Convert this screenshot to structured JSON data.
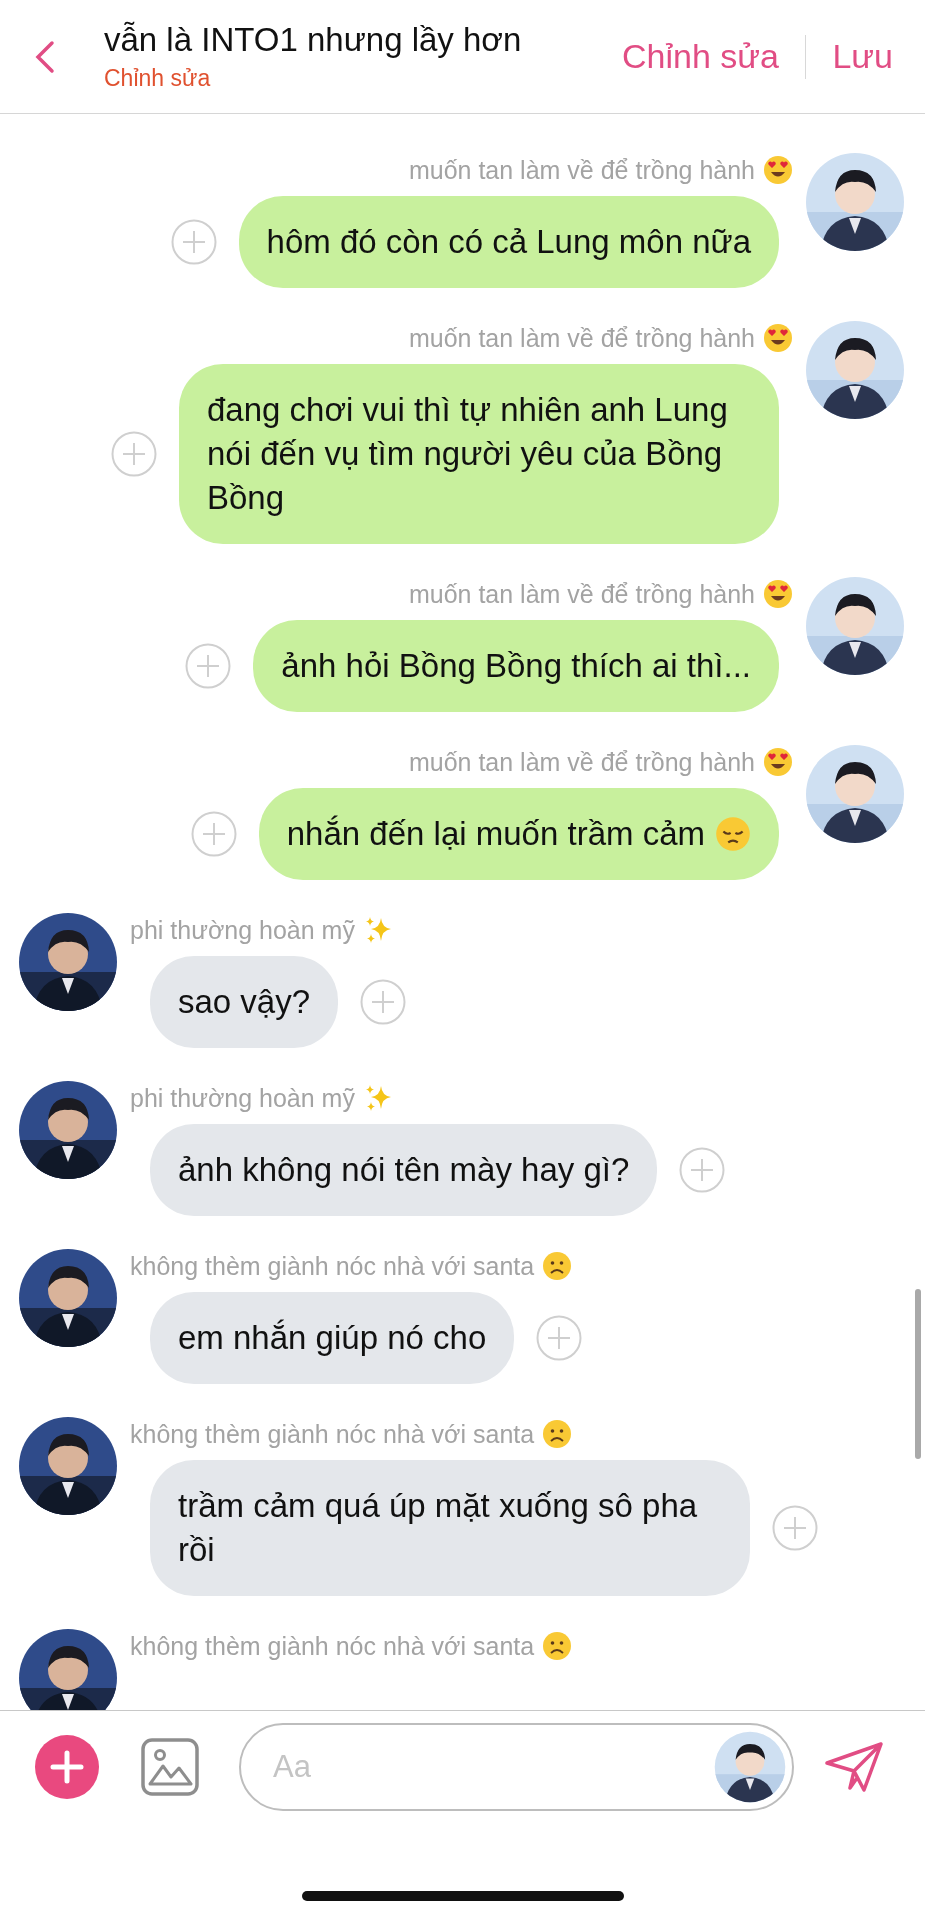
{
  "header": {
    "title": "vẫn là INTO1 nhưng lầy hơn",
    "subtitle": "Chỉnh sửa",
    "actions": [
      "Chỉnh sửa",
      "Lưu"
    ]
  },
  "messages": [
    {
      "kind": "sent",
      "sender": "muốn tan làm về để trồng hành",
      "sender_emoji": {
        "kind": "heart-eyes"
      },
      "text": "hôm đó còn có cả Lung môn nữa"
    },
    {
      "kind": "sent",
      "sender": "muốn tan làm về để trồng hành",
      "sender_emoji": {
        "kind": "heart-eyes"
      },
      "text": "đang chơi vui thì tự nhiên anh Lung nói đến vụ tìm người yêu của Bồng Bồng"
    },
    {
      "kind": "sent",
      "sender": "muốn tan làm về để trồng hành",
      "sender_emoji": {
        "kind": "heart-eyes"
      },
      "text": "ảnh hỏi Bồng Bồng thích ai thì..."
    },
    {
      "kind": "sent",
      "sender": "muốn tan làm về để trồng hành",
      "sender_emoji": {
        "kind": "heart-eyes"
      },
      "text": "nhắn đến lại muốn trầm cảm",
      "text_emoji": {
        "kind": "pensive"
      }
    },
    {
      "kind": "received",
      "sender": "phi thường hoàn mỹ",
      "sender_emoji": {
        "kind": "sparkles"
      },
      "text": "sao vậy?"
    },
    {
      "kind": "received",
      "sender": "phi thường hoàn mỹ",
      "sender_emoji": {
        "kind": "sparkles"
      },
      "text": "ảnh không nói tên mày hay gì?"
    },
    {
      "kind": "received",
      "sender": "không thèm giành nóc nhà với santa",
      "sender_emoji": {
        "kind": "frowning"
      },
      "text": "em nhắn giúp nó cho"
    },
    {
      "kind": "received",
      "sender": "không thèm giành nóc nhà với santa",
      "sender_emoji": {
        "kind": "frowning"
      },
      "text": "trầm cảm quá úp mặt xuống sô pha rồi"
    },
    {
      "kind": "received",
      "sender": "không thèm giành nóc nhà với santa",
      "sender_emoji": {
        "kind": "frowning"
      }
    }
  ],
  "composer": {
    "placeholder": "Aa"
  }
}
